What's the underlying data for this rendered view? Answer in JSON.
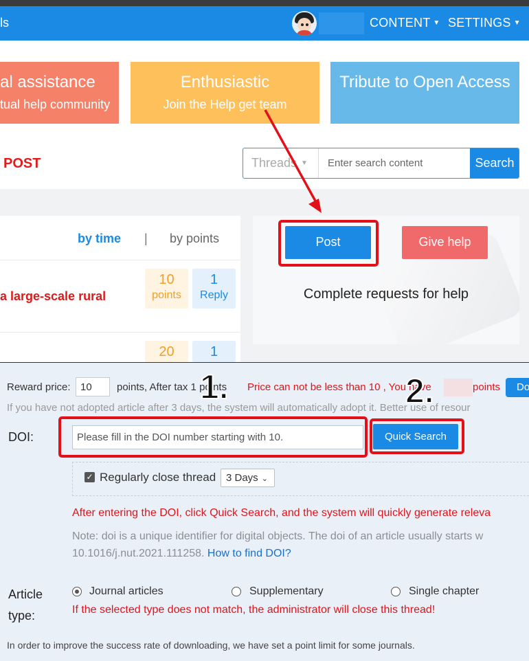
{
  "navbar": {
    "left_text": "ls",
    "content_label": "CONTENT",
    "settings_label": "SETTINGS"
  },
  "tiles": [
    {
      "title": "al assistance",
      "subtitle": "tual help community"
    },
    {
      "title": "Enthusiastic",
      "subtitle": "Join the Help get team"
    },
    {
      "title": "Tribute to Open Access"
    }
  ],
  "search": {
    "section_title": "POST",
    "scope": "Threads",
    "placeholder": "Enter search content",
    "button": "Search"
  },
  "thread_list": {
    "sort_by_time": "by time",
    "separator": "|",
    "sort_by_points": "by points",
    "rows": [
      {
        "title": "a large-scale rural",
        "points_value": "10",
        "points_label": "points",
        "reply_value": "1",
        "reply_label": "Reply"
      },
      {
        "points_value": "20",
        "reply_value": "1"
      }
    ]
  },
  "actions": {
    "post_button": "Post",
    "help_button": "Give help",
    "complete_text": "Complete  requests for help"
  },
  "form": {
    "reward_label": "Reward price:",
    "reward_value": "10",
    "after_tax_text": "points, After tax 1 points",
    "price_warning": "Price can not be less than 10 , You have",
    "points_word": "points",
    "do_button": "Do",
    "adopt_note": "If you have not adopted article after 3 days, the system will automatically adopt it. Better use of resour",
    "doi_label": "DOI:",
    "doi_placeholder": "Please fill in the DOI number starting with 10.",
    "quick_search_button": "Quick Search",
    "close_thread_label": "Regularly close thread",
    "close_days": "3 Days",
    "after_doi_text": "After entering the DOI, click Quick Search, and the system will quickly generate releva",
    "doi_note_line1": "Note: doi is a unique identifier for digital objects. The doi of an article usually starts w",
    "doi_note_line2": "10.1016/j.nut.2021.111258.",
    "doi_help_link": "How to find DOI?",
    "article_type_label_1": "Article",
    "article_type_label_2": "type:",
    "article_types": [
      "Journal articles",
      "Supplementary",
      "Single chapter"
    ],
    "type_warning": "If the selected type does not match, the administrator will close this thread!",
    "bottom_note": "In order to improve the success rate of downloading, we have set a point limit for some journals."
  },
  "annotations": {
    "step1": "1.",
    "step2": "2."
  },
  "colors": {
    "brand_blue": "#1a8ae5",
    "highlight_red": "#e30f19",
    "tile_red": "#f68169",
    "tile_yellow": "#fec05b",
    "tile_blue": "#67b9ea"
  }
}
